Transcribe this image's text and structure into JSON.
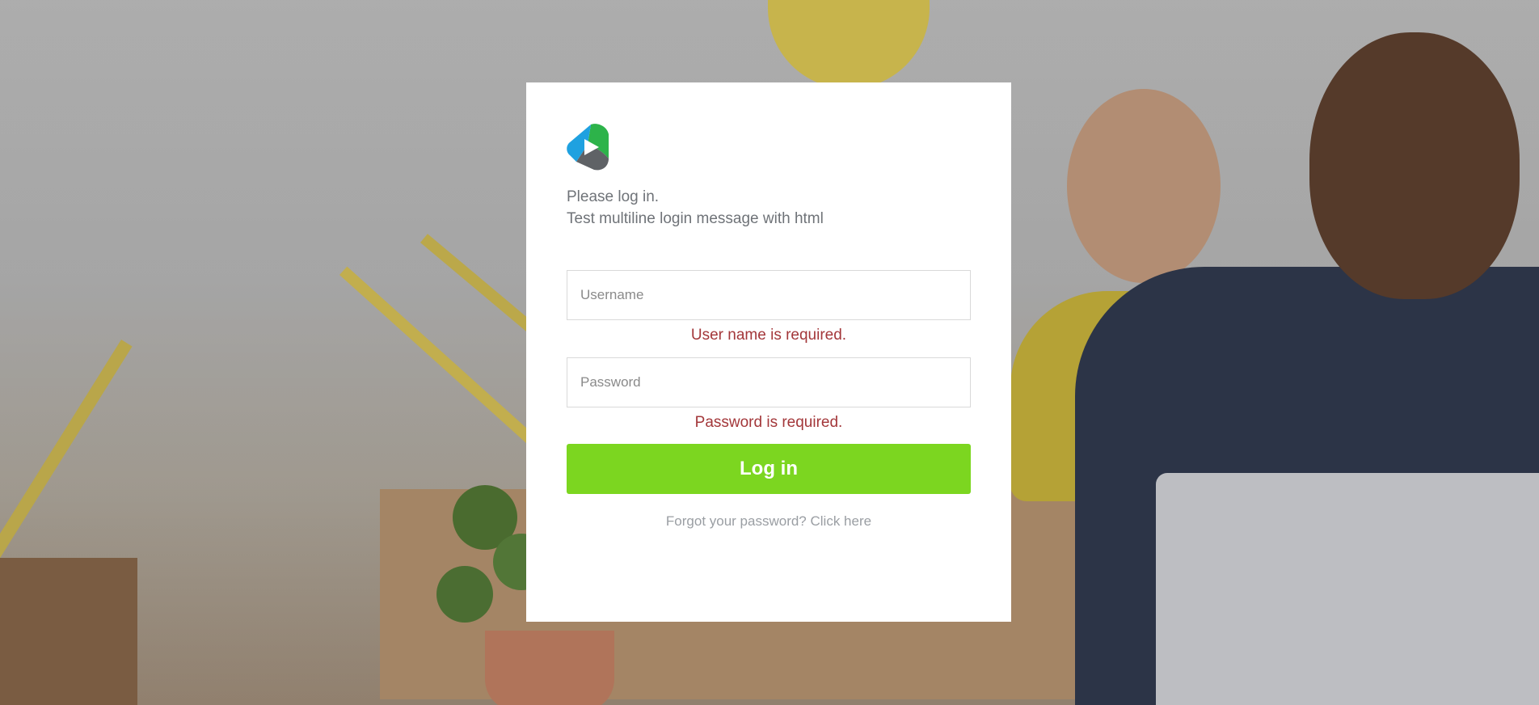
{
  "logo": {
    "icon": "brand-logo-icon",
    "colors": [
      "#2db34a",
      "#1fa1e0",
      "#5f6266"
    ]
  },
  "message": {
    "line1": "Please log in.",
    "line2": "Test multiline login message with html"
  },
  "form": {
    "username_placeholder": "Username",
    "username_value": "",
    "username_error": "User name is required.",
    "password_placeholder": "Password",
    "password_value": "",
    "password_error": "Password is required.",
    "submit_label": "Log in",
    "forgot_link": "Forgot your password? Click here"
  },
  "colors": {
    "button": "#7cd620",
    "error": "#a3373a",
    "muted_text": "#9a9ea3"
  }
}
